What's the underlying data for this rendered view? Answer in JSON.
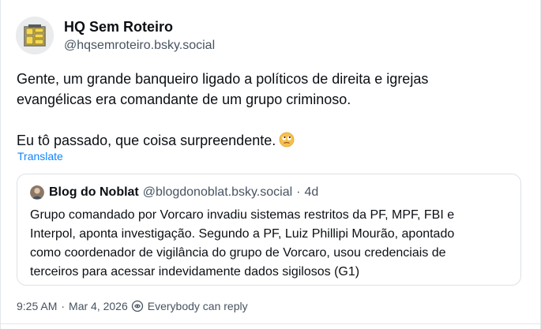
{
  "author": {
    "display_name": "HQ Sem Roteiro",
    "handle": "@hqsemroteiro.bsky.social",
    "avatar_icon": "comic-panels-logo-icon",
    "avatar_colors": {
      "background": "#e9ebec",
      "panels": "#f1c40f",
      "outline": "#6b6b6b"
    }
  },
  "post": {
    "lines": [
      "Gente, um grande banqueiro ligado a políticos de direita e igrejas",
      "evangélicas era comandante de um grupo criminoso."
    ],
    "second_paragraph": "Eu tô passado, que coisa surpreendente.",
    "emoji": "face-with-rolling-eyes-emoji",
    "translate_label": "Translate"
  },
  "quote": {
    "display_name": "Blog do Noblat",
    "handle": "@blogdonoblat.bsky.social",
    "separator": "·",
    "time": "4d",
    "avatar_icon": "person-photo-avatar-icon",
    "lines": [
      "Grupo comandado por Vorcaro invadiu sistemas restritos da PF, MPF, FBI e",
      "Interpol, aponta investigação. Segundo a PF, Luiz Phillipi Mourão, apontado",
      "como coordenador de vigilância do grupo de Vorcaro, usou credenciais de",
      "terceiros para acessar indevidamente dados sigilosos (G1)"
    ]
  },
  "meta": {
    "time": "9:25 AM",
    "separator": "·",
    "date": "Mar 4, 2026",
    "reply_icon": "everybody-reply-icon",
    "reply_setting": "Everybody can reply"
  },
  "colors": {
    "text": "#0b0f14",
    "muted": "#475361",
    "link": "#1083fe",
    "border": "#dde1e6"
  }
}
